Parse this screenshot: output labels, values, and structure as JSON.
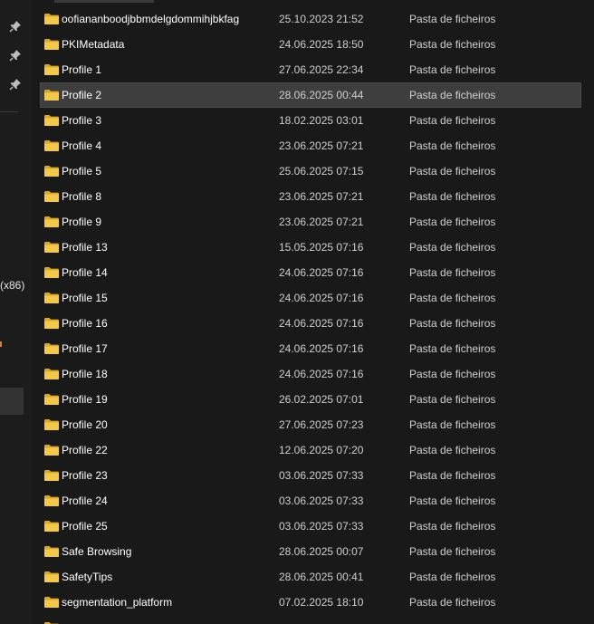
{
  "navigation_pane": {
    "pins": [
      "pin-icon",
      "pin-icon",
      "pin-icon"
    ],
    "partial_text": "(x86)"
  },
  "file_list": {
    "rows": [
      {
        "name": "oofiananboodjbbmdelgdommihjbkfag",
        "date": "25.10.2023 21:52",
        "type": "Pasta de ficheiros",
        "selected": false
      },
      {
        "name": "PKIMetadata",
        "date": "24.06.2025 18:50",
        "type": "Pasta de ficheiros",
        "selected": false
      },
      {
        "name": "Profile 1",
        "date": "27.06.2025 22:34",
        "type": "Pasta de ficheiros",
        "selected": false
      },
      {
        "name": "Profile 2",
        "date": "28.06.2025 00:44",
        "type": "Pasta de ficheiros",
        "selected": true
      },
      {
        "name": "Profile 3",
        "date": "18.02.2025 03:01",
        "type": "Pasta de ficheiros",
        "selected": false
      },
      {
        "name": "Profile 4",
        "date": "23.06.2025 07:21",
        "type": "Pasta de ficheiros",
        "selected": false
      },
      {
        "name": "Profile 5",
        "date": "25.06.2025 07:15",
        "type": "Pasta de ficheiros",
        "selected": false
      },
      {
        "name": "Profile 8",
        "date": "23.06.2025 07:21",
        "type": "Pasta de ficheiros",
        "selected": false
      },
      {
        "name": "Profile 9",
        "date": "23.06.2025 07:21",
        "type": "Pasta de ficheiros",
        "selected": false
      },
      {
        "name": "Profile 13",
        "date": "15.05.2025 07:16",
        "type": "Pasta de ficheiros",
        "selected": false
      },
      {
        "name": "Profile 14",
        "date": "24.06.2025 07:16",
        "type": "Pasta de ficheiros",
        "selected": false
      },
      {
        "name": "Profile 15",
        "date": "24.06.2025 07:16",
        "type": "Pasta de ficheiros",
        "selected": false
      },
      {
        "name": "Profile 16",
        "date": "24.06.2025 07:16",
        "type": "Pasta de ficheiros",
        "selected": false
      },
      {
        "name": "Profile 17",
        "date": "24.06.2025 07:16",
        "type": "Pasta de ficheiros",
        "selected": false
      },
      {
        "name": "Profile 18",
        "date": "24.06.2025 07:16",
        "type": "Pasta de ficheiros",
        "selected": false
      },
      {
        "name": "Profile 19",
        "date": "26.02.2025 07:01",
        "type": "Pasta de ficheiros",
        "selected": false
      },
      {
        "name": "Profile 20",
        "date": "27.06.2025 07:23",
        "type": "Pasta de ficheiros",
        "selected": false
      },
      {
        "name": "Profile 22",
        "date": "12.06.2025 07:20",
        "type": "Pasta de ficheiros",
        "selected": false
      },
      {
        "name": "Profile 23",
        "date": "03.06.2025 07:33",
        "type": "Pasta de ficheiros",
        "selected": false
      },
      {
        "name": "Profile 24",
        "date": "03.06.2025 07:33",
        "type": "Pasta de ficheiros",
        "selected": false
      },
      {
        "name": "Profile 25",
        "date": "03.06.2025 07:33",
        "type": "Pasta de ficheiros",
        "selected": false
      },
      {
        "name": "Safe Browsing",
        "date": "28.06.2025 00:07",
        "type": "Pasta de ficheiros",
        "selected": false
      },
      {
        "name": "SafetyTips",
        "date": "28.06.2025 00:41",
        "type": "Pasta de ficheiros",
        "selected": false
      },
      {
        "name": "segmentation_platform",
        "date": "07.02.2025 18:10",
        "type": "Pasta de ficheiros",
        "selected": false
      },
      {
        "name": "",
        "date": "",
        "type": "",
        "selected": false
      }
    ]
  },
  "colors": {
    "background": "#191919",
    "selected_row": "#3e3e3e",
    "folder_body": "#f2c94c",
    "folder_back": "#d9a72b",
    "text_primary": "#ffffff",
    "text_secondary": "#cfcfcf"
  }
}
